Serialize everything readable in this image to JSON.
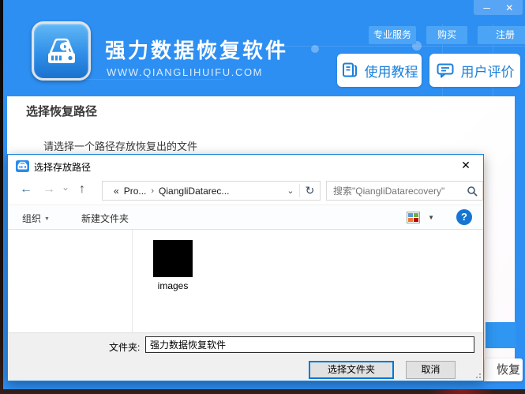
{
  "main_window": {
    "titlebar": {
      "minimize_icon": "─",
      "close_icon": "✕"
    },
    "header": {
      "app_title": "强力数据恢复软件",
      "website": "WWW.QIANGLIHUIFU.COM",
      "links": [
        {
          "label": "专业服务"
        },
        {
          "label": "购买"
        },
        {
          "label": "注册"
        }
      ],
      "tutorial_button": "使用教程",
      "review_button": "用户评价"
    },
    "content": {
      "section_title": "选择恢复路径",
      "instruction": "请选择一个路径存放恢复出的文件",
      "partial_recover_label": "恢复"
    }
  },
  "dialog": {
    "title": "选择存放路径",
    "close_icon": "✕",
    "nav": {
      "back_icon": "←",
      "forward_icon": "→",
      "recent_icon": "⌄",
      "up_icon": "↑",
      "breadcrumb": {
        "overflow": "«",
        "root": "Pro...",
        "separator": "›",
        "current": "QiangliDatarec..."
      },
      "address_dropdown_icon": "⌄",
      "refresh_icon": "↻",
      "search_placeholder": "搜索\"QiangliDatarecovery\""
    },
    "toolbar": {
      "organize": "组织",
      "organize_caret": "▼",
      "new_folder": "新建文件夹",
      "view_caret": "▼",
      "help_icon": "?"
    },
    "files": [
      {
        "name": "images"
      }
    ],
    "footer": {
      "folder_label": "文件夹:",
      "folder_value": "强力数据恢复软件",
      "select_button": "选择文件夹",
      "cancel_button": "取消"
    }
  },
  "colors": {
    "header_blue": "#2e8ff2",
    "accent_blue": "#1b7fd9",
    "dialog_border": "#1884d9",
    "focus_border": "#0078d7"
  }
}
